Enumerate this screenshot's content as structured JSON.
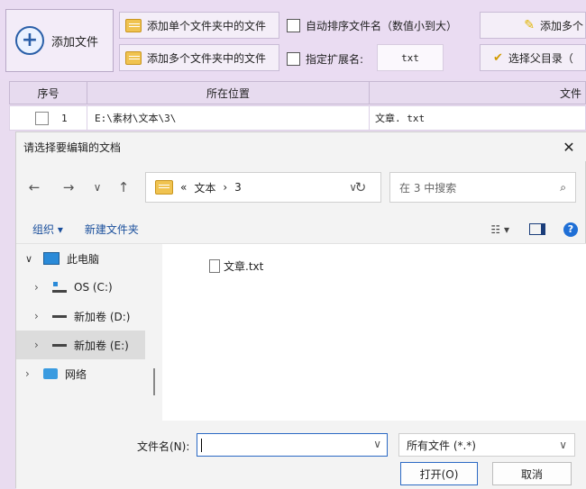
{
  "toolbar": {
    "add_file": "添加文件",
    "add_single_folder": "添加单个文件夹中的文件",
    "add_multi_folder": "添加多个文件夹中的文件",
    "auto_sort": "自动排序文件名（数值小到大）",
    "specify_ext": "指定扩展名:",
    "ext_value": "txt",
    "add_multi_right": "添加多个",
    "select_parent": "选择父目录（",
    "colors": {
      "toolbar_bg": "#eadcf2",
      "accent": "#2a5fa8"
    }
  },
  "table": {
    "headers": [
      "序号",
      "所在位置",
      "文件"
    ],
    "rows": [
      {
        "index": "1",
        "location": "E:\\素材\\文本\\3\\",
        "file": "文章. txt"
      }
    ]
  },
  "dialog": {
    "title": "请选择要编辑的文档",
    "close": "✕",
    "nav": {
      "back": "←",
      "forward": "→",
      "recent": "∨",
      "up": "↑"
    },
    "breadcrumb": {
      "overflow": "«",
      "part1": "文本",
      "sep": "›",
      "part2": "3"
    },
    "search_placeholder": "在 3 中搜索",
    "organize": "组织 ▾",
    "new_folder": "新建文件夹",
    "view_glyph": "☷ ▾",
    "help_glyph": "?",
    "nav_items": [
      {
        "label": "此电脑",
        "chevron": "∨",
        "icon": "computer-icon"
      },
      {
        "label": "OS (C:)",
        "chevron": "›",
        "icon": "windows-drive-icon"
      },
      {
        "label": "新加卷 (D:)",
        "chevron": "›",
        "icon": "drive-icon"
      },
      {
        "label": "新加卷 (E:)",
        "chevron": "›",
        "icon": "drive-icon",
        "selected": true
      },
      {
        "label": "网络",
        "chevron": "›",
        "icon": "network-icon"
      }
    ],
    "files": [
      {
        "name": "文章.txt",
        "icon": "text-file-icon"
      }
    ],
    "filename_label": "文件名(N):",
    "filename_value": "",
    "filetype": "所有文件 (*.*)",
    "open": "打开(O)",
    "cancel": "取消"
  }
}
